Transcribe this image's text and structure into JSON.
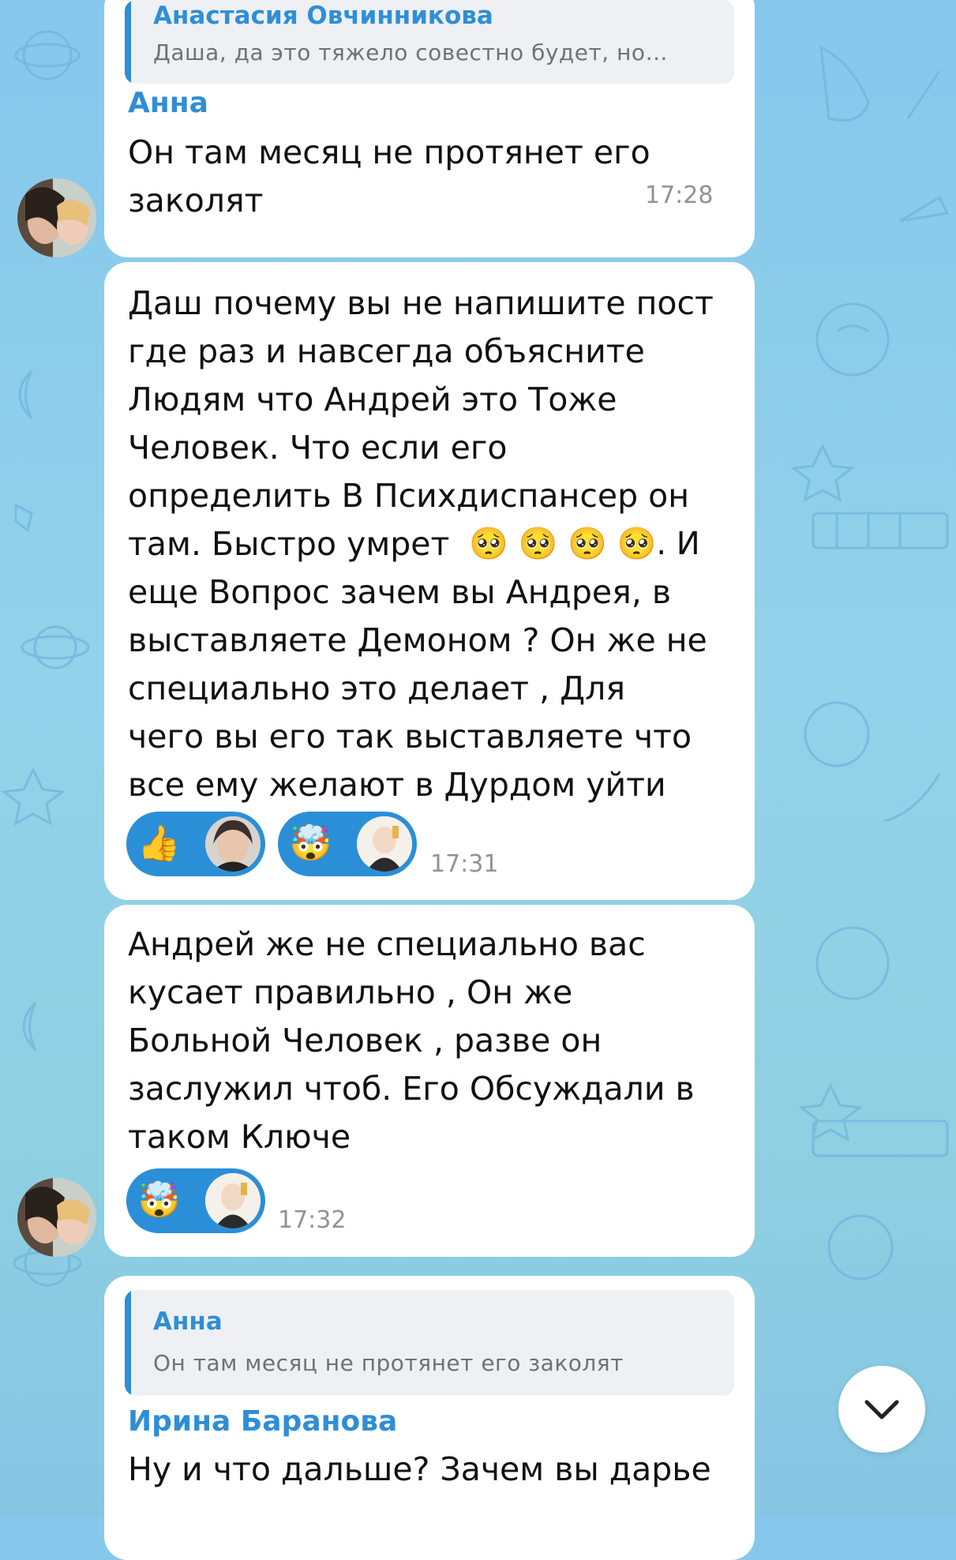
{
  "colors": {
    "accent": "#2f8ed6",
    "bubble": "#ffffff",
    "reaction_bg": "#2b8fd8"
  },
  "messages": [
    {
      "reply": {
        "author": "Анастасия Овчинникова",
        "text": "Даша, да это тяжело совестно будет, но…"
      },
      "sender": "Анна",
      "text": "Он там месяц не протянет его\nзаколят",
      "time": "17:28"
    },
    {
      "text_a": "Даш почему вы не напишите пост\nгде раз и навсегда объясните\nЛюдям что Андрей это Тоже\nЧеловек.  Что если его\nопределить В Психдиспансер он\nтам. Быстро умрет",
      "emoji_line": "🥺 🥺 🥺 🥺.  И",
      "text_b": "еще Вопрос зачем вы Андрея, в\nвыставляете Демоном ? Он же не\nспециально это делает ,    Для\nчего вы его так выставляете что\nвсе ему желают в Дурдом уйти",
      "reactions": [
        {
          "emoji": "👍",
          "icon": "thumbs-up-icon"
        },
        {
          "emoji": "🤯",
          "icon": "exploding-head-icon"
        }
      ],
      "time": "17:31"
    },
    {
      "text": "Андрей же не специально вас\nкусает правильно , Он же\nБольной Человек , разве он\nзаслужил чтоб. Его Обсуждали в\nтаком Ключе",
      "reactions": [
        {
          "emoji": "🤯",
          "icon": "exploding-head-icon"
        }
      ],
      "time": "17:32"
    },
    {
      "reply": {
        "author": "Анна",
        "text": "Он там месяц не протянет его заколят"
      },
      "sender": "Ирина Баранова",
      "text": "Ну и что дальше? Зачем вы дарье"
    }
  ],
  "scroll_button": {
    "icon": "chevron-down-icon"
  }
}
